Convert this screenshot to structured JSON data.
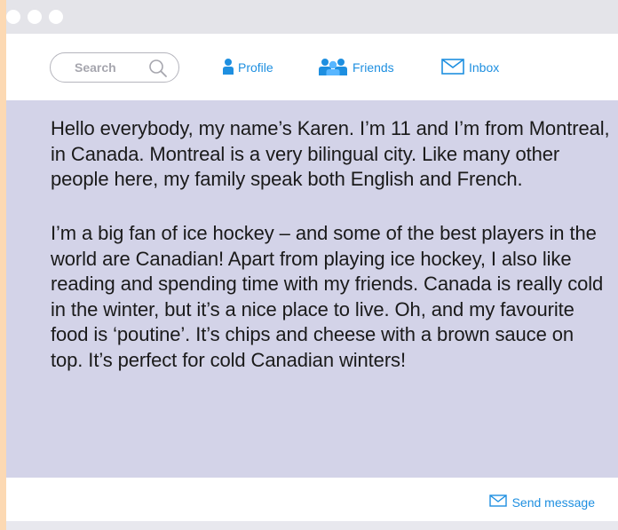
{
  "window": {
    "controls": [
      "close",
      "minimize",
      "maximize"
    ]
  },
  "toolbar": {
    "search": {
      "placeholder": "Search",
      "icon": "search-icon"
    },
    "nav": [
      {
        "label": "Profile",
        "icon": "person-icon"
      },
      {
        "label": "Friends",
        "icon": "friends-icon"
      },
      {
        "label": "Inbox",
        "icon": "envelope-icon"
      }
    ]
  },
  "post": {
    "paragraphs": [
      "Hello everybody, my name’s Karen. I’m 11 and I’m from Montreal, in Canada. Montreal is a very bilingual city. Like many other people here, my family speak both English and French.",
      "I’m a big fan of ice hockey – and some of the best players in the world are Canadian! Apart from playing ice hockey, I also like reading and spending time with my friends. Canada is really cold in the winter, but it’s a nice place to live. Oh, and my favourite food is ‘poutine’. It’s chips and cheese with a brown sauce on top. It’s perfect for cold Canadian winters!"
    ]
  },
  "footer": {
    "send_label": "Send message",
    "send_icon": "envelope-icon"
  },
  "colors": {
    "accent": "#1e8fe0",
    "content_bg": "#d3d3e8",
    "titlebar_bg": "#e4e4e9",
    "left_stripe": "#fcd9b3"
  }
}
